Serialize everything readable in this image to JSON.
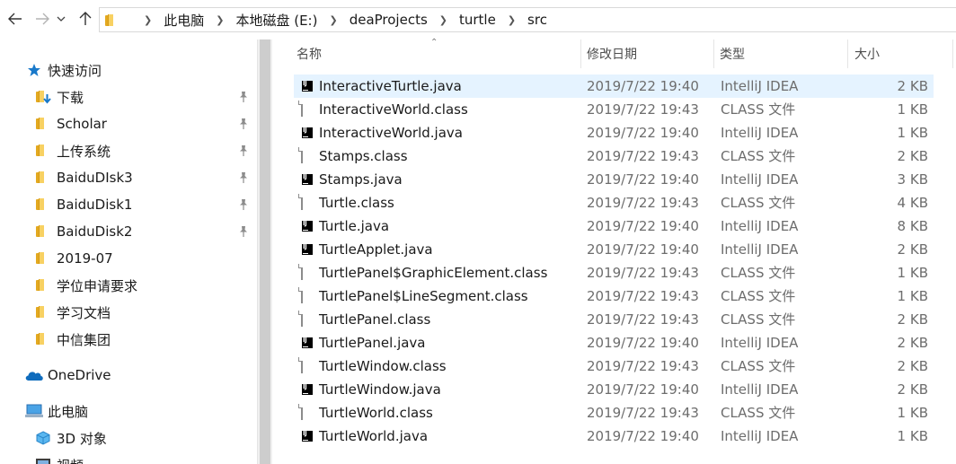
{
  "toolbar": {
    "back_icon": "arrow-left-icon",
    "forward_icon": "arrow-right-icon",
    "recent_icon": "chevron-down-icon",
    "up_icon": "arrow-up-icon"
  },
  "breadcrumb": [
    "此电脑",
    "本地磁盘 (E:)",
    "deaProjects",
    "turtle",
    "src"
  ],
  "nav": {
    "quick_access": "快速访问",
    "items": [
      {
        "label": "下载",
        "pinned": true,
        "icon": "download-folder-icon"
      },
      {
        "label": "Scholar",
        "pinned": true,
        "icon": "folder-icon"
      },
      {
        "label": "上传系统",
        "pinned": true,
        "icon": "folder-icon"
      },
      {
        "label": "BaiduDIsk3",
        "pinned": true,
        "icon": "folder-icon"
      },
      {
        "label": "BaiduDisk1",
        "pinned": true,
        "icon": "folder-icon"
      },
      {
        "label": "BaiduDisk2",
        "pinned": true,
        "icon": "folder-icon"
      },
      {
        "label": "2019-07",
        "pinned": false,
        "icon": "folder-icon"
      },
      {
        "label": "学位申请要求",
        "pinned": false,
        "icon": "folder-icon"
      },
      {
        "label": "学习文档",
        "pinned": false,
        "icon": "folder-icon"
      },
      {
        "label": "中信集团",
        "pinned": false,
        "icon": "folder-icon"
      }
    ],
    "onedrive": "OneDrive",
    "this_pc": "此电脑",
    "objects_3d": "3D 对象",
    "video_partial": "视频"
  },
  "columns": {
    "name": "名称",
    "date": "修改日期",
    "type": "类型",
    "size": "大小"
  },
  "files": [
    {
      "name": "InteractiveTurtle.java",
      "date": "2019/7/22 19:40",
      "type": "IntelliJ IDEA",
      "size": "2 KB",
      "kind": "java",
      "selected": true
    },
    {
      "name": "InteractiveWorld.class",
      "date": "2019/7/22 19:43",
      "type": "CLASS 文件",
      "size": "1 KB",
      "kind": "class"
    },
    {
      "name": "InteractiveWorld.java",
      "date": "2019/7/22 19:40",
      "type": "IntelliJ IDEA",
      "size": "1 KB",
      "kind": "java"
    },
    {
      "name": "Stamps.class",
      "date": "2019/7/22 19:43",
      "type": "CLASS 文件",
      "size": "2 KB",
      "kind": "class"
    },
    {
      "name": "Stamps.java",
      "date": "2019/7/22 19:40",
      "type": "IntelliJ IDEA",
      "size": "3 KB",
      "kind": "java"
    },
    {
      "name": "Turtle.class",
      "date": "2019/7/22 19:43",
      "type": "CLASS 文件",
      "size": "4 KB",
      "kind": "class"
    },
    {
      "name": "Turtle.java",
      "date": "2019/7/22 19:40",
      "type": "IntelliJ IDEA",
      "size": "8 KB",
      "kind": "java"
    },
    {
      "name": "TurtleApplet.java",
      "date": "2019/7/22 19:40",
      "type": "IntelliJ IDEA",
      "size": "2 KB",
      "kind": "java"
    },
    {
      "name": "TurtlePanel$GraphicElement.class",
      "date": "2019/7/22 19:43",
      "type": "CLASS 文件",
      "size": "1 KB",
      "kind": "class"
    },
    {
      "name": "TurtlePanel$LineSegment.class",
      "date": "2019/7/22 19:43",
      "type": "CLASS 文件",
      "size": "1 KB",
      "kind": "class"
    },
    {
      "name": "TurtlePanel.class",
      "date": "2019/7/22 19:43",
      "type": "CLASS 文件",
      "size": "2 KB",
      "kind": "class"
    },
    {
      "name": "TurtlePanel.java",
      "date": "2019/7/22 19:40",
      "type": "IntelliJ IDEA",
      "size": "2 KB",
      "kind": "java"
    },
    {
      "name": "TurtleWindow.class",
      "date": "2019/7/22 19:43",
      "type": "CLASS 文件",
      "size": "2 KB",
      "kind": "class"
    },
    {
      "name": "TurtleWindow.java",
      "date": "2019/7/22 19:40",
      "type": "IntelliJ IDEA",
      "size": "2 KB",
      "kind": "java"
    },
    {
      "name": "TurtleWorld.class",
      "date": "2019/7/22 19:43",
      "type": "CLASS 文件",
      "size": "1 KB",
      "kind": "class"
    },
    {
      "name": "TurtleWorld.java",
      "date": "2019/7/22 19:40",
      "type": "IntelliJ IDEA",
      "size": "1 KB",
      "kind": "java"
    }
  ],
  "colors": {
    "selection": "#e5f3ff",
    "folder": "#f8d162",
    "quick_access_star": "#1979ca",
    "onedrive": "#0f6cbd"
  }
}
